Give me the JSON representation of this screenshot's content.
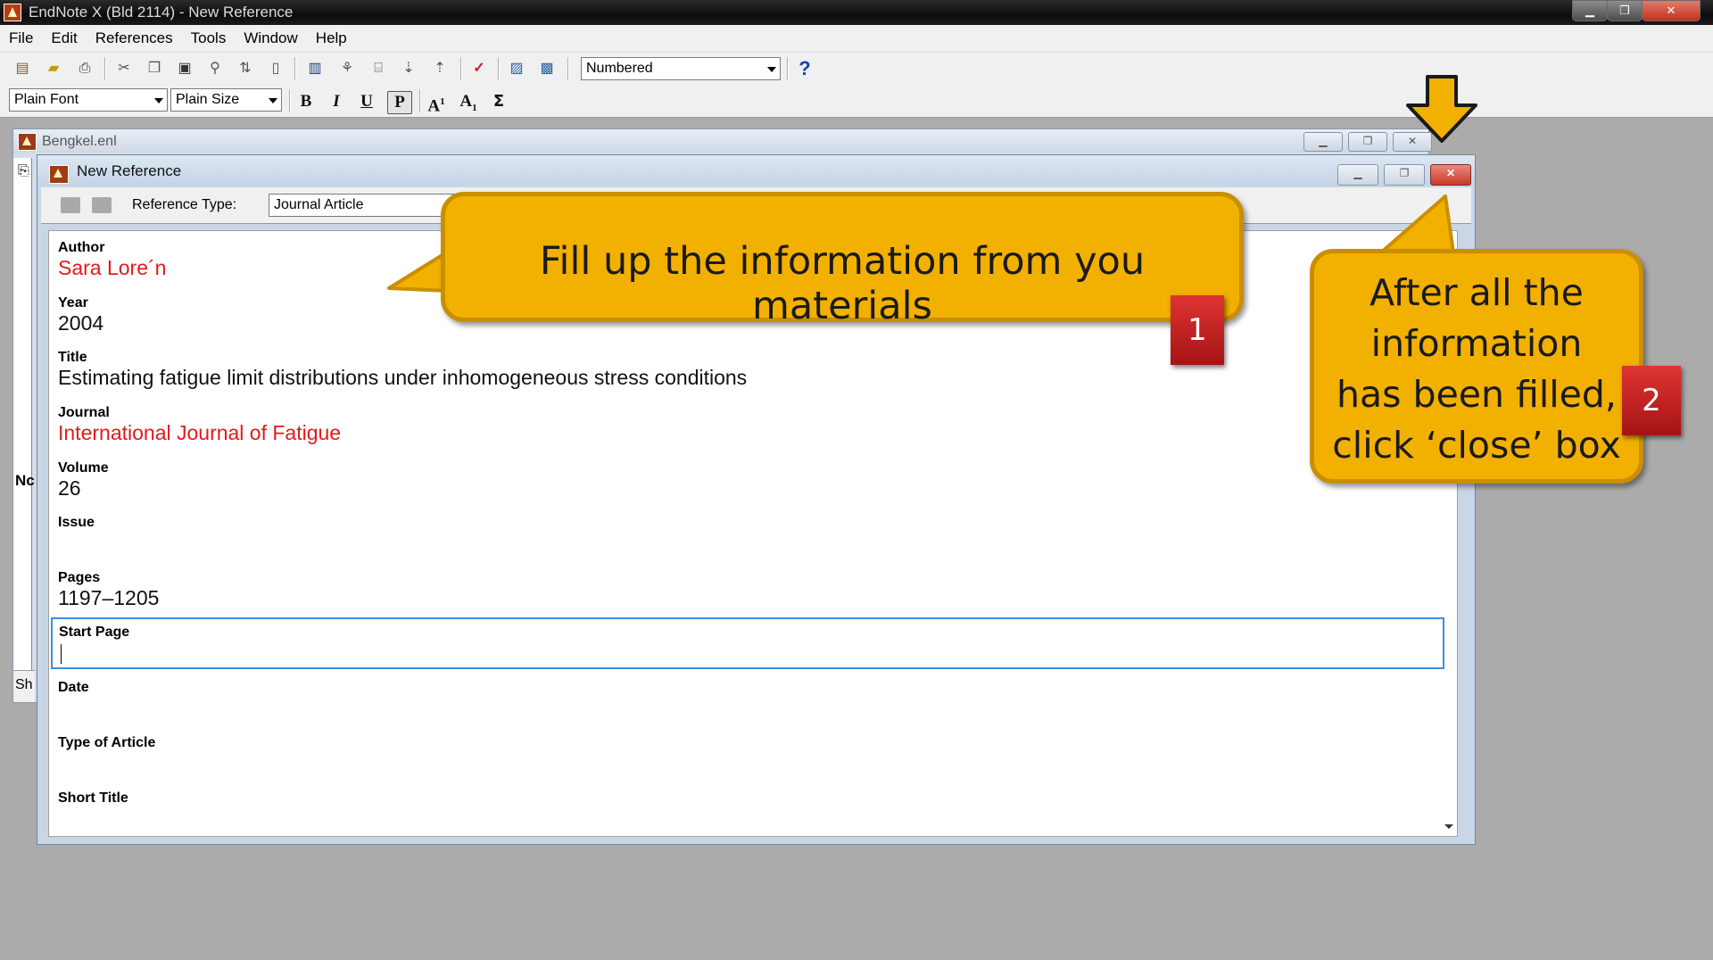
{
  "window": {
    "title": "EndNote X (Bld 2114) - New Reference",
    "minimize_icon": "minimize-icon",
    "restore_icon": "restore-icon",
    "close_icon": "close-icon"
  },
  "menu": [
    "File",
    "Edit",
    "References",
    "Tools",
    "Window",
    "Help"
  ],
  "toolbar": {
    "style_select": "Numbered",
    "help_label": "?",
    "font_select": "Plain Font",
    "size_select": "Plain Size",
    "bold": "B",
    "italic": "I",
    "underline": "U",
    "plain": "P",
    "superscript": "A",
    "superscript_mark": "1",
    "subscript": "A",
    "subscript_mark": "1",
    "symbol": "Σ"
  },
  "library_window": {
    "title": "Bengkel.enl",
    "side_label_1": "Nc",
    "side_label_2": "Sh"
  },
  "new_reference": {
    "title": "New Reference",
    "reference_type_label": "Reference Type:",
    "reference_type_value": "Journal Article",
    "fields": [
      {
        "label": "Author",
        "value": "Sara Lore´n"
      },
      {
        "label": "Year",
        "value": "2004"
      },
      {
        "label": "Title",
        "value": "Estimating fatigue limit distributions under inhomogeneous stress conditions"
      },
      {
        "label": "Journal",
        "value": "International Journal of Fatigue"
      },
      {
        "label": "Volume",
        "value": "26"
      },
      {
        "label": "Issue",
        "value": ""
      },
      {
        "label": "Pages",
        "value": "1197–1205"
      },
      {
        "label": "Start Page",
        "value": ""
      },
      {
        "label": "Date",
        "value": ""
      },
      {
        "label": "Type of Article",
        "value": ""
      },
      {
        "label": "Short Title",
        "value": ""
      }
    ]
  },
  "annotations": {
    "callout1": "Fill up the information from you materials",
    "badge1": "1",
    "callout2_lines": [
      "After all the",
      "information",
      "has been filled,",
      "click ‘close’ box"
    ],
    "badge2": "2"
  },
  "colors": {
    "callout_fill": "#f2b000",
    "badge_fill": "#c41e1e",
    "field_highlight": "#e21a1a",
    "focus_border": "#3d8ee0"
  }
}
